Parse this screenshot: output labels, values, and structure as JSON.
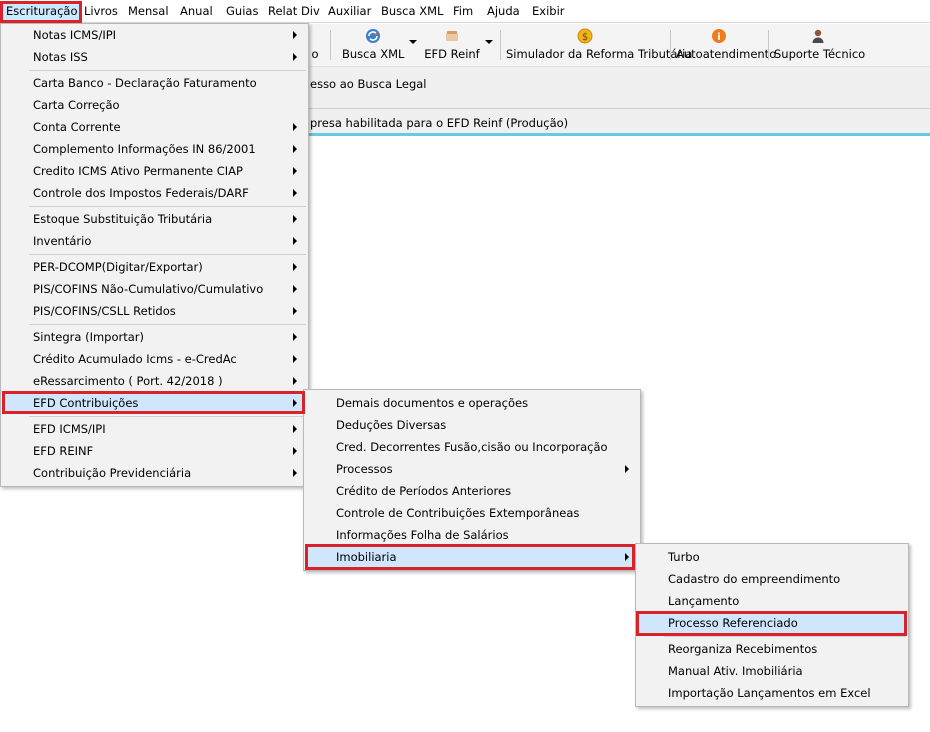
{
  "menubar": {
    "items": [
      "Escrituração",
      "Livros",
      "Mensal",
      "Anual",
      "Guias",
      "Relat Div",
      "Auxiliar",
      "Busca XML",
      "Fim",
      "Ajuda",
      "Exibir"
    ]
  },
  "toolbar": {
    "partial_label": "o",
    "buttons": [
      "Busca XML",
      "EFD Reinf",
      "Simulador da Reforma Tributária",
      "Autoatendimento",
      "Suporte Técnico"
    ]
  },
  "panel": {
    "line1": "esso ao Busca Legal",
    "line2": "presa habilitada para o EFD Reinf (Produção)"
  },
  "menu1": {
    "items": [
      "Notas ICMS/IPI",
      "Notas ISS",
      "Carta Banco - Declaração Faturamento",
      "Carta Correção",
      "Conta Corrente",
      "Complemento Informações IN 86/2001",
      "Credito ICMS Ativo Permanente CIAP",
      "Controle dos Impostos Federais/DARF",
      "Estoque Substituição Tributária",
      "Inventário",
      "PER-DCOMP(Digitar/Exportar)",
      "PIS/COFINS Não-Cumulativo/Cumulativo",
      "PIS/COFINS/CSLL Retidos",
      "Sintegra (Importar)",
      "Crédito Acumulado Icms - e-CredAc",
      "eRessarcimento ( Port. 42/2018 )",
      "EFD Contribuições",
      "EFD ICMS/IPI",
      "EFD REINF",
      "Contribuição Previdenciária"
    ]
  },
  "menu2": {
    "items": [
      "Demais documentos e operações",
      "Deduções Diversas",
      "Cred. Decorrentes Fusão,cisão ou Incorporação",
      "Processos",
      "Crédito de Períodos Anteriores",
      "Controle de Contribuições Extemporâneas",
      "Informações Folha de Salários",
      "Imobiliaria"
    ]
  },
  "menu3": {
    "items": [
      "Turbo",
      "Cadastro do empreendimento",
      "Lançamento",
      "Processo Referenciado",
      "Reorganiza Recebimentos",
      "Manual Ativ. Imobiliária",
      "Importação Lançamentos em Excel"
    ]
  },
  "colors": {
    "highlight": "#cfe6fc",
    "annotation_red": "#d8232a",
    "status_bar_accent": "#6cc6e6"
  },
  "icons": {
    "busca_xml": "refresh-globe-icon",
    "efd_reinf": "folder-stack-icon",
    "simulador": "dollar-coin-icon",
    "autoatendimento": "info-icon",
    "suporte": "support-person-icon"
  }
}
